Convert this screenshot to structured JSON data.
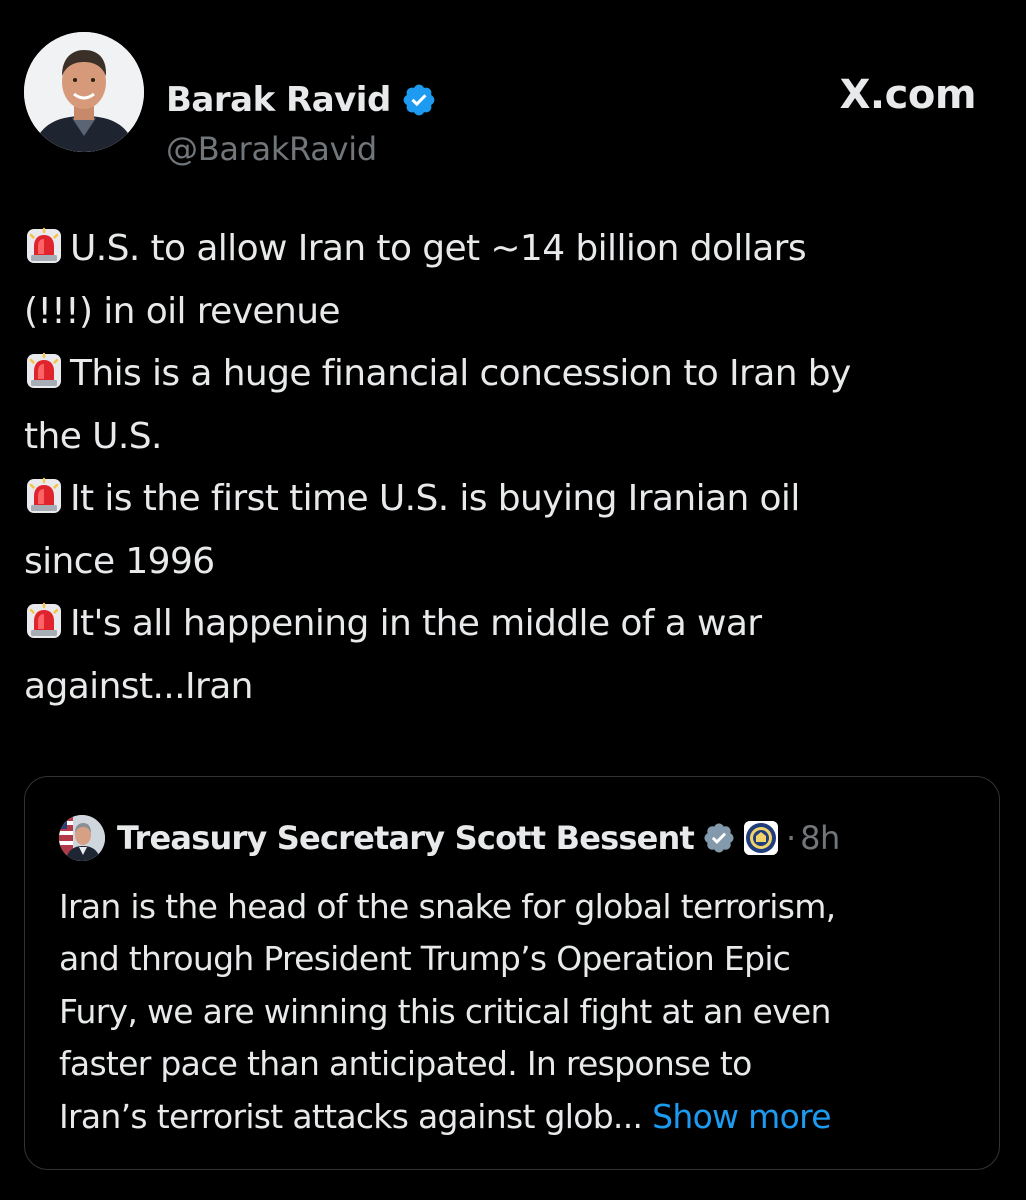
{
  "brand": {
    "site_label": "X.com"
  },
  "author": {
    "display_name": "Barak Ravid",
    "handle": "@BarakRavid",
    "verified_color": "#1d9bf0"
  },
  "tweet": {
    "bullet_icon": "rotating-light-siren-emoji",
    "lines": [
      {
        "has_icon": true,
        "text": "U.S. to allow Iran to get ~14 billion dollars"
      },
      {
        "has_icon": false,
        "text": "(!!!) in oil revenue"
      },
      {
        "has_icon": true,
        "text": "This is a huge financial concession to Iran by"
      },
      {
        "has_icon": false,
        "text": "the U.S."
      },
      {
        "has_icon": true,
        "text": "It is the first time U.S. is buying Iranian oil"
      },
      {
        "has_icon": false,
        "text": "since 1996"
      },
      {
        "has_icon": true,
        "text": "It's all happening in the middle of a war"
      },
      {
        "has_icon": false,
        "text": "against...Iran"
      }
    ]
  },
  "quote": {
    "display_name": "Treasury Secretary Scott Bessent",
    "verified_color": "#829aab",
    "affiliate_badge": "treasury-seal",
    "separator": "·",
    "time": "8h",
    "lines": [
      "Iran is the head of the snake for global terrorism,",
      "and through President Trump’s Operation Epic",
      "Fury, we are winning this critical fight at an even",
      "faster pace than anticipated.  In response to",
      "Iran’s terrorist attacks against glob..."
    ],
    "show_more_label": "Show more"
  },
  "colors": {
    "background": "#000000",
    "text": "#e7e9ea",
    "muted": "#71767b",
    "link": "#1d9bf0",
    "border": "#2f3336"
  }
}
